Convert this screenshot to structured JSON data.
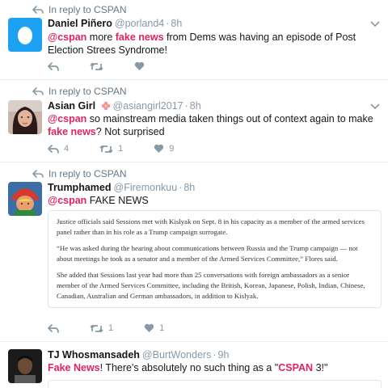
{
  "tweets": [
    {
      "reply_prefix": "In reply to",
      "reply_to": "CSPAN",
      "name": "Daniel Piñero",
      "handle": "@porland4",
      "time": "8h",
      "segments": [
        {
          "text": "@cspan",
          "style": "mention"
        },
        {
          "text": " more ",
          "style": "plain"
        },
        {
          "text": "fake news",
          "style": "em"
        },
        {
          "text": " from Dems was having an episode of Post Election Strees Syndrome!",
          "style": "plain"
        }
      ],
      "actions": {
        "reply": "",
        "retweet": "",
        "like": ""
      }
    },
    {
      "reply_prefix": "In reply to",
      "reply_to": "CSPAN",
      "name": "Asian Girl",
      "handle": "@asiangirl2017",
      "time": "8h",
      "segments": [
        {
          "text": "@cspan",
          "style": "mention"
        },
        {
          "text": " so mainstream media taken things out of context again to make ",
          "style": "plain"
        },
        {
          "text": "fake news",
          "style": "em"
        },
        {
          "text": "? Not surprised",
          "style": "plain"
        }
      ],
      "actions": {
        "reply": "4",
        "retweet": "1",
        "like": "9"
      }
    },
    {
      "reply_prefix": "In reply to",
      "reply_to": "CSPAN",
      "name": "Trumphamed",
      "handle": "@Firemonkuu",
      "time": "8h",
      "segments": [
        {
          "text": "@cspan",
          "style": "mention"
        },
        {
          "text": " FAKE NEWS",
          "style": "plain"
        }
      ],
      "quote_paragraphs": [
        "Justice officials said Sessions met with Kislyak on Sept. 8 in his capacity as a member of the armed services panel rather than in his role as a Trump campaign surrogate.",
        "“He was asked during the hearing about communications between Russia and the Trump campaign — not about meetings he took as a senator and a member of the Armed Services Committee,” Flores said.",
        "She added that Sessions last year had more than 25 conversations with foreign ambassadors as a senior member of the Armed Services Committee, including the British, Korean, Japanese, Polish, Indian, Chinese, Canadian, Australian and German ambassadors, in addition to Kislyak."
      ],
      "actions": {
        "reply": "",
        "retweet": "1",
        "like": "1"
      }
    },
    {
      "name": "TJ Whosmansadeh",
      "handle": "@BurtWonders",
      "time": "9h",
      "segments": [
        {
          "text": "Fake News",
          "style": "em"
        },
        {
          "text": "! There's absolutely no such thing as a \"",
          "style": "plain"
        },
        {
          "text": "CSPAN",
          "style": "em"
        },
        {
          "text": " 3!\"",
          "style": "plain"
        }
      ]
    }
  ],
  "colors": {
    "accent": "#e0245e",
    "meta": "#8899a6",
    "egg_bg": "#1da1f2"
  },
  "icons": [
    "reply-arrow-icon",
    "chevron-down-icon",
    "reply-icon",
    "retweet-icon",
    "heart-icon",
    "flower-emoji-icon"
  ]
}
